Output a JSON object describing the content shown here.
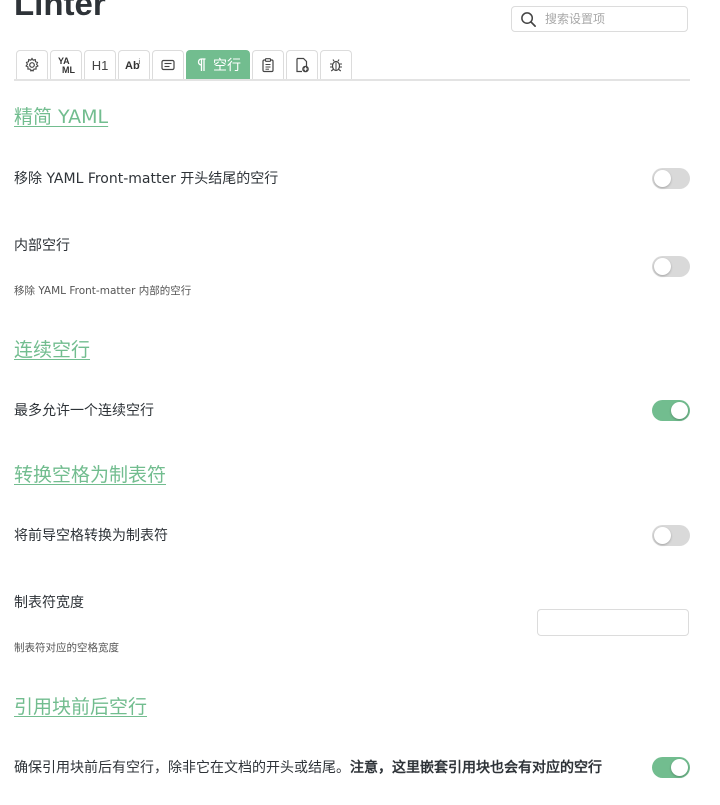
{
  "header": {
    "title": "Linter"
  },
  "search": {
    "placeholder": "搜索设置项"
  },
  "tabs": [
    {
      "icon": "gear-icon"
    },
    {
      "icon": "yaml-icon",
      "text": "YAML"
    },
    {
      "icon": "heading-icon",
      "text": "H1"
    },
    {
      "icon": "ab-icon",
      "text": "Ab"
    },
    {
      "icon": "content-icon"
    },
    {
      "icon": "pilcrow-icon",
      "label": "空行",
      "active": true
    },
    {
      "icon": "clipboard-icon"
    },
    {
      "icon": "file-plus-icon"
    },
    {
      "icon": "bug-icon"
    }
  ],
  "sections": [
    {
      "heading": "精简 YAML",
      "settings": [
        {
          "name": "移除 YAML Front-matter 开头结尾的空行",
          "enabled": false
        },
        {
          "name": "内部空行",
          "desc": "移除 YAML Front-matter 内部的空行",
          "enabled": false
        }
      ]
    },
    {
      "heading": "连续空行",
      "settings": [
        {
          "name": "最多允许一个连续空行",
          "enabled": true
        }
      ]
    },
    {
      "heading": "转换空格为制表符",
      "settings": [
        {
          "name": "将前导空格转换为制表符",
          "enabled": false
        },
        {
          "name": "制表符宽度",
          "desc": "制表符对应的空格宽度",
          "value": ""
        }
      ]
    },
    {
      "heading": "引用块前后空行",
      "settings": [
        {
          "name": "确保引用块前后有空行，除非它在文档的开头或结尾。",
          "name_bold": "注意，这里嵌套引用块也会有对应的空行",
          "enabled": true
        }
      ]
    }
  ],
  "colors": {
    "accent": "#72bd8f",
    "toggle_off": "#d9d9d9",
    "text": "#2e3338"
  }
}
